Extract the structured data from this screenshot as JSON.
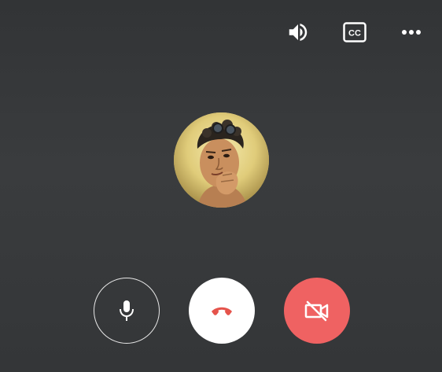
{
  "top_bar": {
    "icons": [
      "volume-icon",
      "closed-captions-icon",
      "more-options-icon"
    ],
    "captions_label": "CC"
  },
  "avatar": {
    "icon": "user-avatar"
  },
  "controls": {
    "icons": [
      "microphone-icon",
      "end-call-icon",
      "video-off-icon"
    ]
  },
  "colors": {
    "background": "#37393b",
    "end_call_icon": "#e5534b",
    "video_off_button": "#ef6262",
    "icon_light": "#ffffff"
  }
}
